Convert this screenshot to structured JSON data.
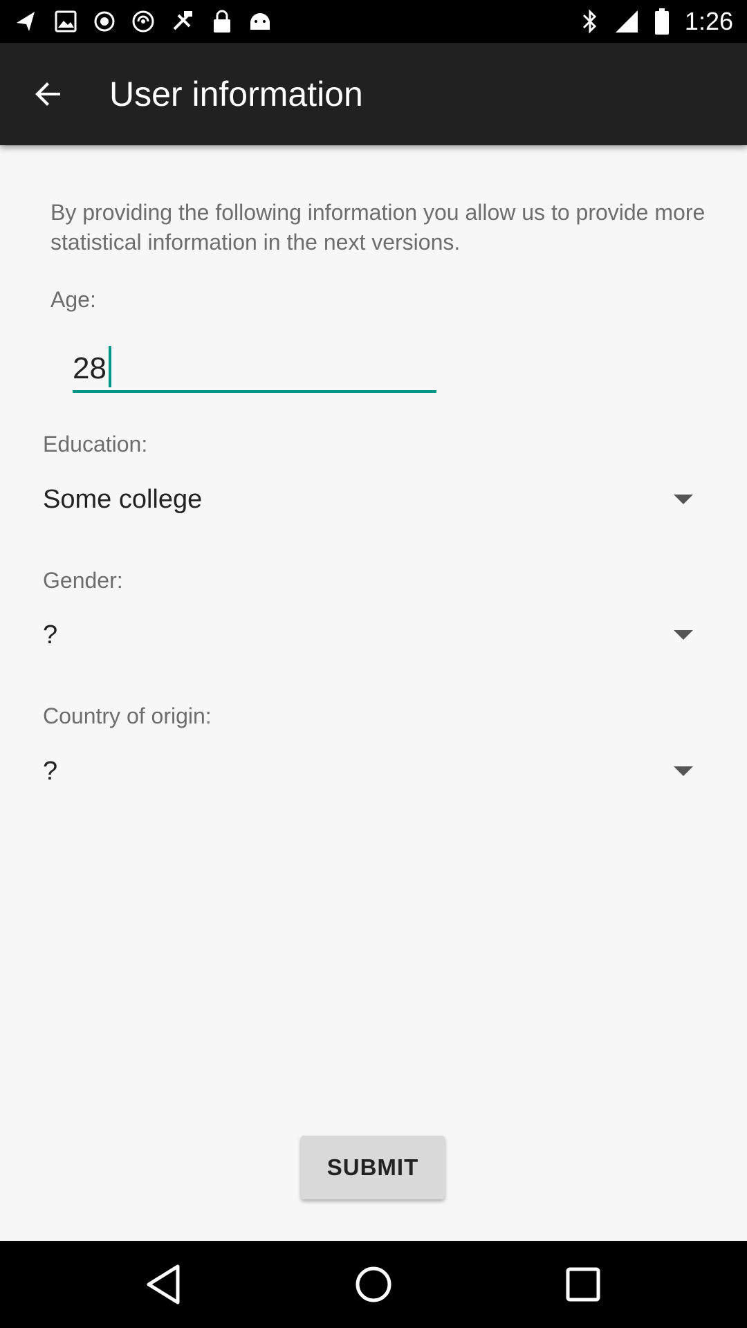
{
  "status_bar": {
    "time": "1:26",
    "icons_left": [
      "notification-arrow-icon",
      "photo-icon",
      "vpn-icon",
      "cast-icon",
      "no-sim-icon",
      "location-fake-icon",
      "lock-icon",
      "android-icon"
    ],
    "icons_right": [
      "bluetooth-icon",
      "signal-icon",
      "battery-icon"
    ]
  },
  "app_bar": {
    "title": "User information",
    "back_icon": "arrow-back-icon"
  },
  "form": {
    "intro": "By providing the following information you allow us to provide more statistical information in the next versions.",
    "age_label": "Age:",
    "age_value": "28",
    "education_label": "Education:",
    "education_value": "Some college",
    "gender_label": "Gender:",
    "gender_value": "?",
    "country_label": "Country of origin:",
    "country_value": "?"
  },
  "submit_label": "SUBMIT",
  "colors": {
    "app_bar": "#212121",
    "accent": "#009688",
    "background": "#f7f7f7",
    "button": "#d9d9d9"
  },
  "nav_bar": {
    "back_icon": "nav-back-icon",
    "home_icon": "nav-home-icon",
    "recents_icon": "nav-recents-icon"
  }
}
